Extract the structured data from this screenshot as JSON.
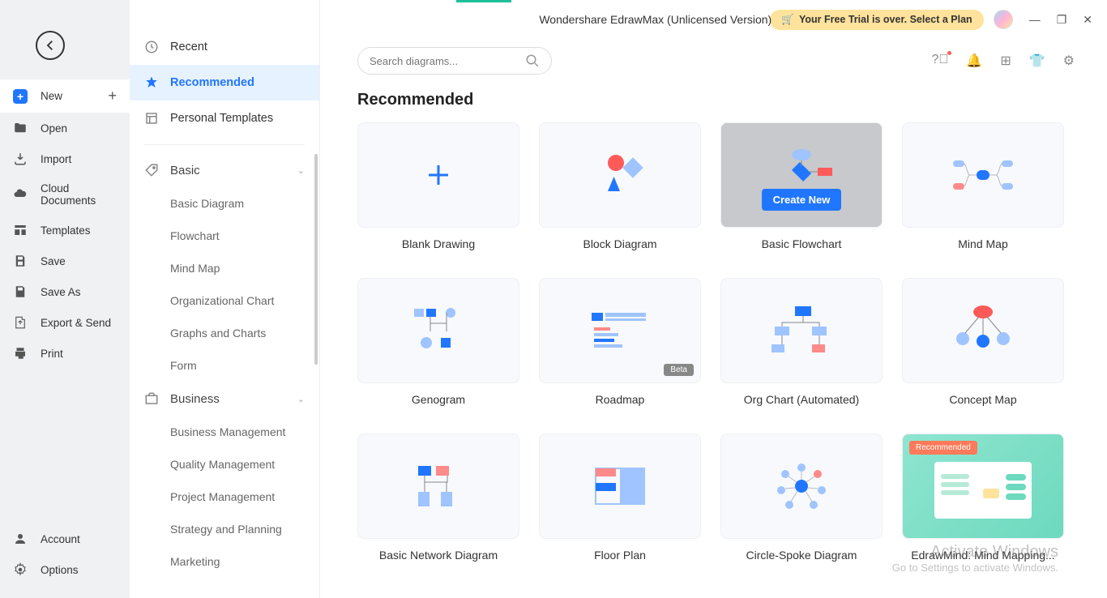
{
  "app": {
    "title": "Wondershare EdrawMax (Unlicensed Version)",
    "trial_message": "Your Free Trial is over. Select a Plan"
  },
  "left_nav": {
    "new": "New",
    "open": "Open",
    "import": "Import",
    "cloud_documents": "Cloud Documents",
    "templates": "Templates",
    "save": "Save",
    "save_as": "Save As",
    "export_send": "Export & Send",
    "print": "Print",
    "account": "Account",
    "options": "Options"
  },
  "mid_nav": {
    "recent": "Recent",
    "recommended": "Recommended",
    "personal_templates": "Personal Templates",
    "categories": [
      {
        "label": "Basic",
        "items": [
          "Basic Diagram",
          "Flowchart",
          "Mind Map",
          "Organizational Chart",
          "Graphs and Charts",
          "Form"
        ]
      },
      {
        "label": "Business",
        "items": [
          "Business Management",
          "Quality Management",
          "Project Management",
          "Strategy and Planning",
          "Marketing"
        ]
      }
    ]
  },
  "search": {
    "placeholder": "Search diagrams..."
  },
  "main": {
    "section_title": "Recommended",
    "create_label": "Create New",
    "beta_label": "Beta",
    "recommended_label": "Recommended",
    "cards": [
      {
        "label": "Blank Drawing"
      },
      {
        "label": "Block Diagram"
      },
      {
        "label": "Basic Flowchart"
      },
      {
        "label": "Mind Map"
      },
      {
        "label": "Genogram"
      },
      {
        "label": "Roadmap"
      },
      {
        "label": "Org Chart (Automated)"
      },
      {
        "label": "Concept Map"
      },
      {
        "label": "Basic Network Diagram"
      },
      {
        "label": "Floor Plan"
      },
      {
        "label": "Circle-Spoke Diagram"
      },
      {
        "label": "EdrawMind: Mind Mapping..."
      }
    ]
  },
  "watermark": {
    "line1": "Activate Windows",
    "line2": "Go to Settings to activate Windows."
  }
}
